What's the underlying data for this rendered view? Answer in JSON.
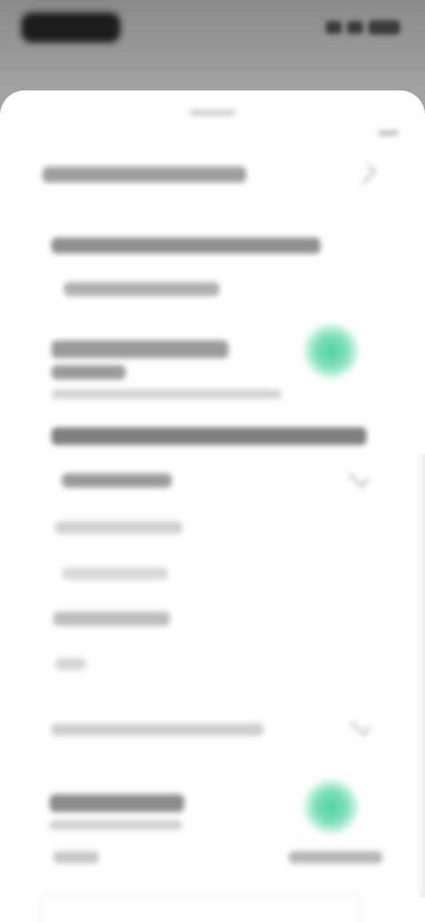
{
  "colors": {
    "accent": "#4fd3a1",
    "text_dark": "#2b2b2b",
    "text_muted": "#9b9b9b",
    "dim_overlay": "#a3a3a3"
  },
  "status_bar": {
    "time": "",
    "icons": [
      "signal-icon",
      "wifi-icon",
      "battery-icon"
    ]
  },
  "sheet": {
    "title": "",
    "header_row": "",
    "section_1_heading": "",
    "section_1_item": "",
    "toggle_1_label": "",
    "toggle_1_sub": "",
    "toggle_1_on": true,
    "section_2_heading": "",
    "section_2_items": [
      "",
      "",
      "",
      "",
      ""
    ],
    "dropdown_label": "",
    "toggle_2_label": "",
    "toggle_2_sub": "",
    "toggle_2_on": true,
    "footer_left": "",
    "footer_right": ""
  }
}
